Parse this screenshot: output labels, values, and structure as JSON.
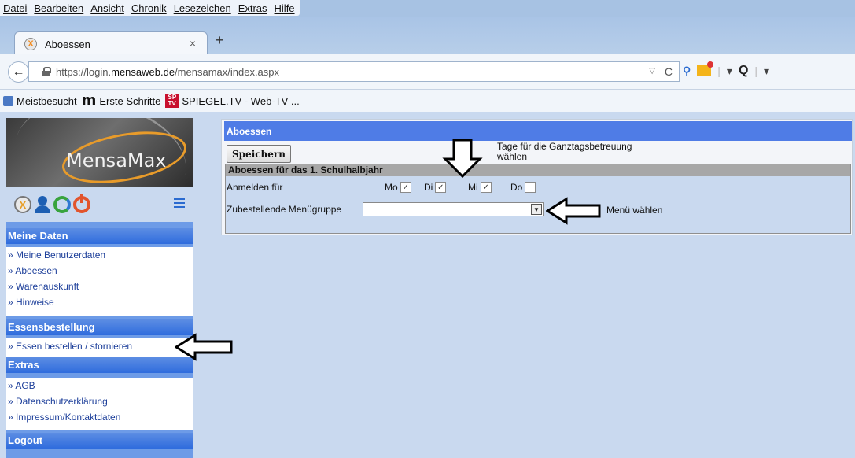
{
  "browser": {
    "menu": [
      "Datei",
      "Bearbeiten",
      "Ansicht",
      "Chronik",
      "Lesezeichen",
      "Extras",
      "Hilfe"
    ],
    "tab": {
      "title": "Aboessen",
      "close": "×"
    },
    "new_tab": "+",
    "url": {
      "prefix": "https://login.",
      "domain": "mensaweb.de",
      "path": "/mensamax/index.aspx"
    },
    "bookmarks": [
      "Meistbesucht",
      "Erste Schritte",
      "SPIEGEL.TV - Web-TV ..."
    ]
  },
  "sidebar": {
    "logo_text": "MensaMax",
    "sections": [
      {
        "title": "Meine Daten",
        "items": [
          "» Meine Benutzerdaten",
          "» Aboessen",
          "» Warenauskunft",
          "» Hinweise"
        ]
      },
      {
        "title": "Essensbestellung",
        "items": [
          "» Essen bestellen / stornieren"
        ]
      },
      {
        "title": "Extras",
        "items": [
          "» AGB",
          "» Datenschutzerklärung",
          "» Impressum/Kontaktdaten"
        ]
      },
      {
        "title": "Logout",
        "items": []
      }
    ]
  },
  "main": {
    "title": "Aboessen",
    "save_label": "Speichern",
    "hint_days": "Tage für die Ganztagsbetreuung wählen",
    "sub_title": "Aboessen für das 1. Schulhalbjahr",
    "register_label": "Anmelden für",
    "days": [
      {
        "label": "Mo",
        "checked": true
      },
      {
        "label": "Di",
        "checked": true
      },
      {
        "label": "Mi",
        "checked": true
      },
      {
        "label": "Do",
        "checked": false
      }
    ],
    "menu_group_label": "Zubestellende Menügruppe",
    "menu_group_value": "",
    "hint_menu": "Menü wählen"
  }
}
